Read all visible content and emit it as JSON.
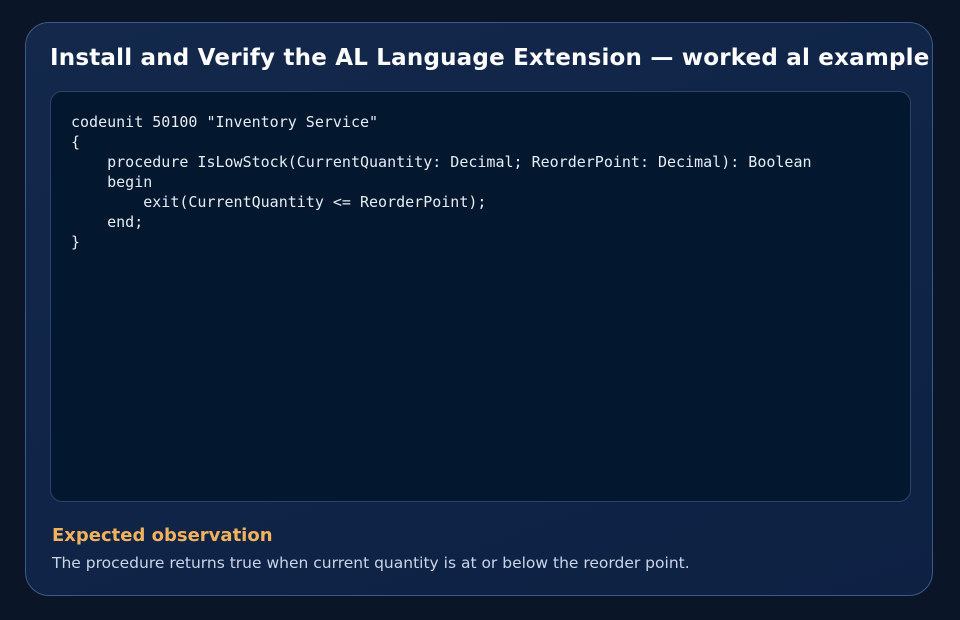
{
  "title": "Install and Verify the AL Language Extension — worked al example",
  "code": {
    "language": "al",
    "lines": [
      "codeunit 50100 \"Inventory Service\"",
      "{",
      "    procedure IsLowStock(CurrentQuantity: Decimal; ReorderPoint: Decimal): Boolean",
      "    begin",
      "        exit(CurrentQuantity <= ReorderPoint);",
      "    end;",
      "}"
    ]
  },
  "observation": {
    "heading": "Expected observation",
    "text": "The procedure returns true when current quantity is at or below the reorder point."
  },
  "colors": {
    "page_background": "#0b1528",
    "card_background": "#0f2447",
    "card_border": "#3d5a85",
    "code_background": "#03182f",
    "title_text": "#ffffff",
    "code_text": "#e6ecf5",
    "heading_accent": "#f2b25c",
    "body_text": "#c9d5e8"
  }
}
